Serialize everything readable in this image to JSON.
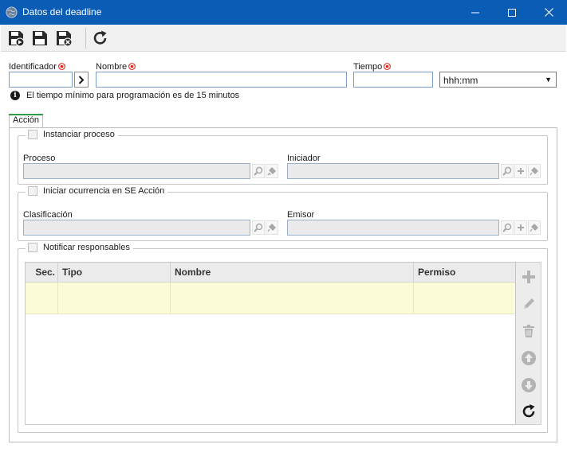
{
  "window": {
    "title": "Datos del deadline",
    "accent": "#0a5cb5"
  },
  "toolbar": {
    "buttons": [
      "save-new-icon",
      "save-icon",
      "save-close-icon",
      "refresh-icon"
    ]
  },
  "form": {
    "identificador_label": "Identificador",
    "identificador_value": "",
    "nombre_label": "Nombre",
    "nombre_value": "",
    "tiempo_label": "Tiempo",
    "tiempo_value": "",
    "tiempo_unit": "hhh:mm",
    "info_text": "El tiempo mínimo para programación es de 15 minutos"
  },
  "tabs": [
    {
      "label": "Acción",
      "active": true
    }
  ],
  "sections": {
    "instanciar": {
      "label": "Instanciar proceso",
      "checked": false,
      "proceso_label": "Proceso",
      "iniciador_label": "Iniciador"
    },
    "ocurrencia": {
      "label": "Iniciar ocurrencia en SE Acción",
      "checked": false,
      "clasificacion_label": "Clasificación",
      "emisor_label": "Emisor"
    },
    "notificar": {
      "label": "Notificar responsables",
      "checked": false,
      "columns": [
        "Sec.",
        "Tipo",
        "Nombre",
        "Permiso"
      ],
      "rows": [
        [
          "",
          "",
          "",
          ""
        ]
      ]
    }
  },
  "colors": {
    "required": "#d9261c",
    "selected_row": "#fbfbd8",
    "tab_accent": "#2f9e44"
  }
}
